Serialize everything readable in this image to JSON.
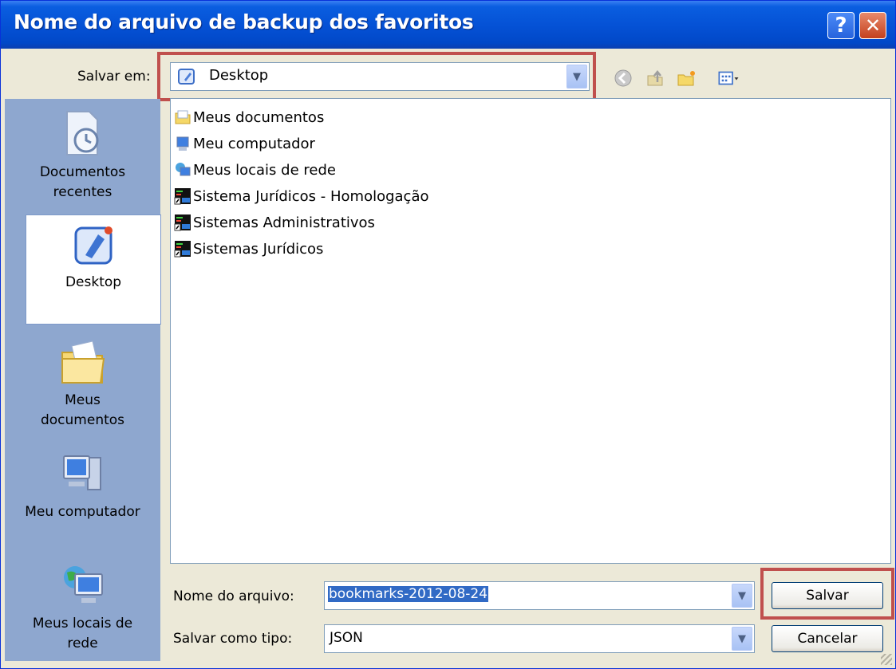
{
  "window": {
    "title": "Nome do arquivo de backup dos favoritos"
  },
  "titlebar_buttons": {
    "help": "?",
    "close": "✕"
  },
  "save_in": {
    "label": "Salvar em:",
    "value": "Desktop"
  },
  "places": [
    {
      "id": "recent",
      "label_line1": "Documentos",
      "label_line2": "recentes",
      "icon": "recent-documents-icon"
    },
    {
      "id": "desktop",
      "label_line1": "Desktop",
      "label_line2": "",
      "icon": "desktop-icon"
    },
    {
      "id": "mydocs",
      "label_line1": "Meus",
      "label_line2": "documentos",
      "icon": "my-documents-folder-icon"
    },
    {
      "id": "mycomputer",
      "label_line1": "Meu computador",
      "label_line2": "",
      "icon": "my-computer-icon"
    },
    {
      "id": "network",
      "label_line1": "Meus locais de",
      "label_line2": "rede",
      "icon": "network-places-icon"
    }
  ],
  "files": [
    {
      "name": "Meus documentos",
      "icon": "folder-icon"
    },
    {
      "name": "Meu computador",
      "icon": "computer-icon"
    },
    {
      "name": "Meus locais de rede",
      "icon": "network-icon"
    },
    {
      "name": "Sistema Jurídicos - Homologação",
      "icon": "shortcut-app-icon"
    },
    {
      "name": "Sistemas Administrativos",
      "icon": "shortcut-app-icon"
    },
    {
      "name": "Sistemas Jurídicos",
      "icon": "shortcut-app-icon"
    }
  ],
  "filename": {
    "label": "Nome do arquivo:",
    "value": "bookmarks-2012-08-24"
  },
  "filetype": {
    "label": "Salvar como tipo:",
    "value": "JSON"
  },
  "buttons": {
    "save": "Salvar",
    "cancel": "Cancelar"
  },
  "colors": {
    "titlebar": "#0552d6",
    "highlight_box": "#c0504d",
    "places_bar": "#8ea7cf",
    "selection": "#316ac5"
  }
}
